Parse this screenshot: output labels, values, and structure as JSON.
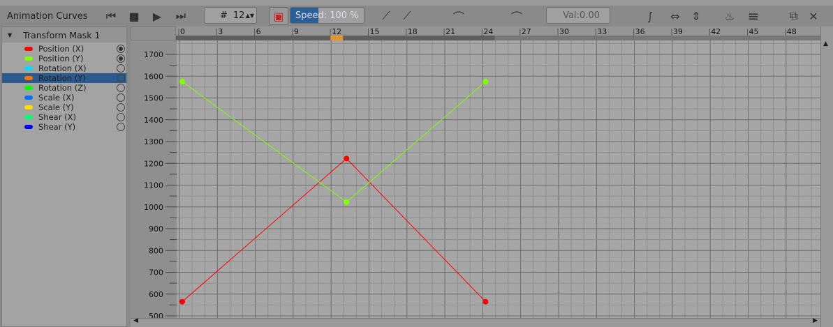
{
  "title": "Animation Curves",
  "toolbar": {
    "frame_prefix": "#",
    "frame": "12",
    "speed_label": "Speed: 100 %",
    "speed_percent": 100,
    "value_field": "Val:0.00",
    "icons": [
      "previous-keyframe-icon",
      "stop-icon",
      "play-icon",
      "next-keyframe-icon",
      "drop-frames-icon",
      "add-keyframe-icon",
      "remove-keyframe-icon",
      "interpolation-mode-icon",
      "tangent-mode-icon",
      "zoom-fit-curve-icon",
      "zoom-horizontal-icon",
      "zoom-vertical-icon",
      "onion-skin-icon",
      "menu-icon",
      "float-icon",
      "close-icon"
    ]
  },
  "layer": {
    "name": "Transform Mask 1"
  },
  "channels": [
    {
      "name": "Position (X)",
      "color": "#ff0000",
      "visible": true
    },
    {
      "name": "Position (Y)",
      "color": "#80ff00",
      "visible": true
    },
    {
      "name": "Rotation (X)",
      "color": "#00ddff",
      "visible": false
    },
    {
      "name": "Rotation (Y)",
      "color": "#ff7000",
      "visible": false,
      "selected": true
    },
    {
      "name": "Rotation (Z)",
      "color": "#00ff00",
      "visible": false
    },
    {
      "name": "Scale (X)",
      "color": "#0070ff",
      "visible": false
    },
    {
      "name": "Scale (Y)",
      "color": "#ffdd00",
      "visible": false
    },
    {
      "name": "Shear (X)",
      "color": "#00ff70",
      "visible": false
    },
    {
      "name": "Shear (Y)",
      "color": "#0000ff",
      "visible": false
    }
  ],
  "chart_data": {
    "type": "line",
    "x_ticks": [
      "0",
      "3",
      "6",
      "9",
      "12",
      "15",
      "18",
      "21",
      "24",
      "27",
      "30",
      "33",
      "36",
      "39",
      "42",
      "45",
      "48"
    ],
    "y_ticks": [
      "1700",
      "1600",
      "1500",
      "1400",
      "1300",
      "1200",
      "1100",
      "1000",
      "900",
      "800",
      "700",
      "600",
      "500"
    ],
    "xlim": [
      0,
      50
    ],
    "ylim": [
      500,
      1710
    ],
    "current_frame": 12,
    "series": [
      {
        "name": "Position (X)",
        "color": "#ff0000",
        "points": [
          [
            0,
            565
          ],
          [
            13,
            1222
          ],
          [
            24,
            565
          ]
        ]
      },
      {
        "name": "Position (Y)",
        "color": "#80ff00",
        "points": [
          [
            0,
            1575
          ],
          [
            13,
            1022
          ],
          [
            24,
            1575
          ]
        ]
      }
    ]
  }
}
